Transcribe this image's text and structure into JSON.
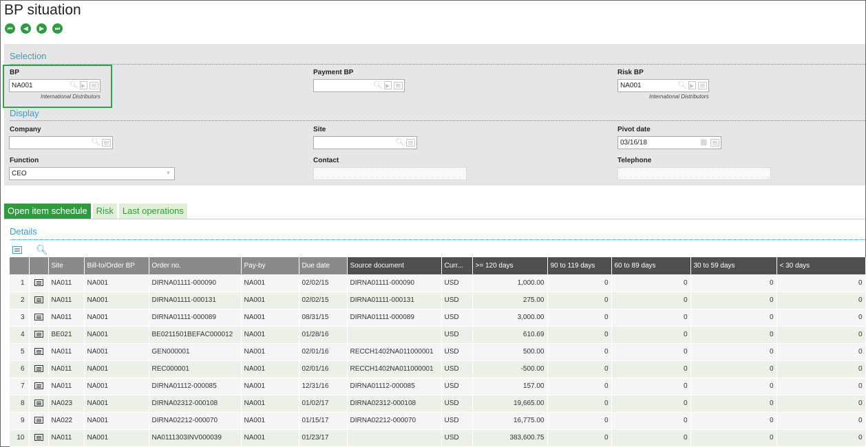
{
  "page": {
    "title": "BP situation"
  },
  "nav": {
    "first": "first-record",
    "prev": "previous-record",
    "next": "next-record",
    "last": "last-record"
  },
  "selection": {
    "title": "Selection",
    "bp": {
      "label": "BP",
      "value": "NA001",
      "caption": "International Distributors"
    },
    "payment_bp": {
      "label": "Payment BP",
      "value": ""
    },
    "risk_bp": {
      "label": "Risk BP",
      "value": "NA001",
      "caption": "International Distributors"
    }
  },
  "display": {
    "title": "Display",
    "company": {
      "label": "Company",
      "value": ""
    },
    "site": {
      "label": "Site",
      "value": ""
    },
    "pivot_date": {
      "label": "Pivot date",
      "value": "03/16/18"
    },
    "function": {
      "label": "Function",
      "value": "CEO"
    },
    "contact": {
      "label": "Contact",
      "value": ""
    },
    "telephone": {
      "label": "Telephone",
      "value": ""
    }
  },
  "tabs": [
    {
      "label": "Open item schedule",
      "active": true
    },
    {
      "label": "Risk",
      "active": false
    },
    {
      "label": "Last operations",
      "active": false
    }
  ],
  "details": {
    "title": "Details",
    "columns": [
      "",
      "",
      "Site",
      "Bill-to/Order BP",
      "Order no.",
      "Pay-by",
      "Due date",
      "Source document",
      "Curr...",
      ">= 120 days",
      "90 to 119 days",
      "60 to 89 days",
      "30 to 59 days",
      "< 30 days"
    ],
    "rows": [
      [
        "1",
        "NA011",
        "NA001",
        "DIRNA01111-000090",
        "NA001",
        "02/02/15",
        "DIRNA01111-000090",
        "USD",
        "1,000.00",
        "0",
        "0",
        "0",
        "0"
      ],
      [
        "2",
        "NA011",
        "NA001",
        "DIRNA01111-000131",
        "NA001",
        "02/02/15",
        "DIRNA01111-000131",
        "USD",
        "275.00",
        "0",
        "0",
        "0",
        "0"
      ],
      [
        "3",
        "NA011",
        "NA001",
        "DIRNA01111-000089",
        "NA001",
        "08/31/15",
        "DIRNA01111-000089",
        "USD",
        "3,000.00",
        "0",
        "0",
        "0",
        "0"
      ],
      [
        "4",
        "BE021",
        "NA001",
        "BE0211501BEFAC000012",
        "NA001",
        "01/28/16",
        "",
        "USD",
        "610.69",
        "0",
        "0",
        "0",
        "0"
      ],
      [
        "5",
        "NA011",
        "NA001",
        "GEN000001",
        "NA001",
        "02/01/16",
        "RECCH1402NA011000001",
        "USD",
        "500.00",
        "0",
        "0",
        "0",
        "0"
      ],
      [
        "6",
        "NA011",
        "NA001",
        "REC000001",
        "NA001",
        "02/01/16",
        "RECCH1402NA011000001",
        "USD",
        "-500.00",
        "0",
        "0",
        "0",
        "0"
      ],
      [
        "7",
        "NA011",
        "NA001",
        "DIRNA01112-000085",
        "NA001",
        "12/31/16",
        "DIRNA01112-000085",
        "USD",
        "157.00",
        "0",
        "0",
        "0",
        "0"
      ],
      [
        "8",
        "NA023",
        "NA001",
        "DIRNA02312-000108",
        "NA001",
        "01/02/17",
        "DIRNA02312-000108",
        "USD",
        "19,665.00",
        "0",
        "0",
        "0",
        "0"
      ],
      [
        "9",
        "NA022",
        "NA001",
        "DIRNA02212-000070",
        "NA001",
        "01/15/17",
        "DIRNA02212-000070",
        "USD",
        "16,775.00",
        "0",
        "0",
        "0",
        "0"
      ],
      [
        "10",
        "NA011",
        "NA001",
        "NA0111303INV000039",
        "NA001",
        "01/23/17",
        "",
        "USD",
        "383,600.75",
        "0",
        "0",
        "0",
        "0"
      ]
    ]
  }
}
